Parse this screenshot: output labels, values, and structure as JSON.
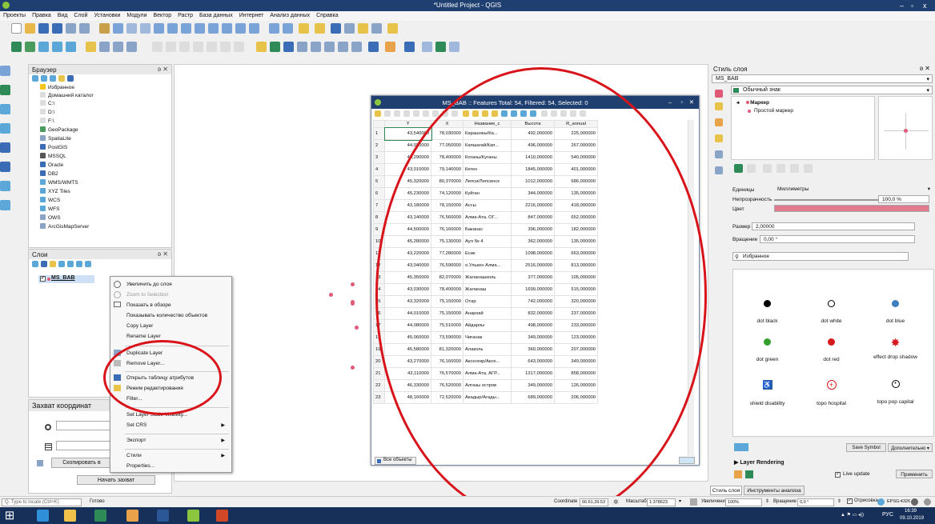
{
  "window": {
    "title": "*Untitled Project - QGIS",
    "controls": [
      "–",
      "▫",
      "x"
    ]
  },
  "menu": [
    "Проекты",
    "Правка",
    "Вид",
    "Слой",
    "Установки",
    "Модули",
    "Вектор",
    "Растр",
    "База данных",
    "Интернет",
    "Анализ данных",
    "Справка"
  ],
  "browser": {
    "title": "Браузер",
    "items": [
      "Избранное",
      "Домашний каталог",
      "C:\\",
      "D:\\",
      "F:\\",
      "GeoPackage",
      "SpatiaLite",
      "PostGIS",
      "MSSQL",
      "Oracle",
      "DB2",
      "WMS/WMTS",
      "XYZ Tiles",
      "WCS",
      "WFS",
      "OWS",
      "ArcGisMapServer"
    ]
  },
  "layers": {
    "title": "Слои",
    "layer_name": "MS_BAB"
  },
  "capture": {
    "title": "Захват координат",
    "copy_button": "Скопировать в",
    "start_button": "Начать захват"
  },
  "context_menu": [
    {
      "label": "Увеличить до слоя",
      "enabled": true
    },
    {
      "label": "Zoom to Selection",
      "enabled": false
    },
    {
      "label": "Показать в обзоре",
      "enabled": true
    },
    {
      "label": "Показывать количество объектов",
      "enabled": true
    },
    {
      "label": "Copy Layer",
      "enabled": true
    },
    {
      "label": "Rename Layer",
      "enabled": true
    },
    {
      "label": "Duplicate Layer",
      "enabled": true
    },
    {
      "label": "Remove Layer...",
      "enabled": true
    },
    {
      "label": "Открыть таблицу атрибутов",
      "enabled": true
    },
    {
      "label": "Режим редактирования",
      "enabled": true
    },
    {
      "label": "Filter...",
      "enabled": true
    },
    {
      "label": "Set Layer Scale Visibility...",
      "enabled": true
    },
    {
      "label": "Set CRS",
      "enabled": true
    },
    {
      "label": "Экспорт",
      "enabled": true
    },
    {
      "label": "Стили",
      "enabled": true
    },
    {
      "label": "Properties...",
      "enabled": true
    }
  ],
  "attribute_table": {
    "title": "MS_BAB :: Features Total: 54, Filtered: 54, Selected: 0",
    "columns": [
      "Y",
      "X",
      "Название_с",
      "Высота",
      "R_annual"
    ],
    "rows": [
      [
        "1",
        "43,540000",
        "78,030000",
        "Карашокы/Ка...",
        "492,000000",
        "225,000000"
      ],
      [
        "2",
        "44,020000",
        "77,050000",
        "Капшагай/Кап...",
        "496,000000",
        "267,000000"
      ],
      [
        "3",
        "44,290000",
        "78,400000",
        "Коганы/Куганы",
        "1410,000000",
        "540,000000"
      ],
      [
        "4",
        "43,010000",
        "79,140000",
        "Кеген",
        "1845,000000",
        "401,000000"
      ],
      [
        "5",
        "45,320000",
        "80,370000",
        "Лепси/Лепсинск",
        "1012,000000",
        "686,000000"
      ],
      [
        "6",
        "45,230000",
        "74,120000",
        "Куйган",
        "344,000000",
        "135,000000"
      ],
      [
        "7",
        "43,180000",
        "78,150000",
        "Ассы",
        "2216,000000",
        "418,000000"
      ],
      [
        "8",
        "43,140000",
        "76,560000",
        "Алма-Ата, ОГ...",
        "847,000000",
        "652,000000"
      ],
      [
        "9",
        "44,500000",
        "76,160000",
        "Баканас",
        "396,000000",
        "182,000000"
      ],
      [
        "10",
        "45,280000",
        "75,130000",
        "Аул № 4",
        "362,000000",
        "135,000000"
      ],
      [
        "11",
        "43,220000",
        "77,280000",
        "Есик",
        "1098,000000",
        "663,000000"
      ],
      [
        "12",
        "43,040000",
        "76,590000",
        "о.Улькен Алма...",
        "2516,000000",
        "813,000000"
      ],
      [
        "13",
        "45,350000",
        "82,070000",
        "Жаланашколь",
        "377,000000",
        "105,000000"
      ],
      [
        "14",
        "43,030000",
        "78,400000",
        "Жаланаш",
        "1699,000000",
        "515,000000"
      ],
      [
        "15",
        "43,320000",
        "75,150000",
        "Отар",
        "742,000000",
        "320,000000"
      ],
      [
        "16",
        "44,010000",
        "75,150000",
        "Анархай",
        "832,000000",
        "237,000000"
      ],
      [
        "17",
        "44,080000",
        "75,510000",
        "Айдарлы",
        "498,000000",
        "233,000000"
      ],
      [
        "18",
        "45,060000",
        "73,590000",
        "Чиганак",
        "349,000000",
        "123,000000"
      ],
      [
        "19",
        "45,580000",
        "81,320000",
        "Алаколь",
        "360,000000",
        "207,000000"
      ],
      [
        "20",
        "43,270000",
        "76,160000",
        "Аксенгир/Аксе...",
        "643,000000",
        "349,000000"
      ],
      [
        "21",
        "43,110000",
        "76,570000",
        "Алма-Ата, АГР...",
        "1317,000000",
        "858,000000"
      ],
      [
        "22",
        "46,330000",
        "76,520000",
        "Алгазы остров",
        "349,000000",
        "126,000000"
      ],
      [
        "23",
        "48,160000",
        "72,520000",
        "Акадыр/Агады...",
        "689,000000",
        "206,000000"
      ]
    ],
    "filter_button": "Все объекты"
  },
  "style_panel": {
    "title": "Стиль слоя",
    "layer_select": "MS_BAB",
    "renderer": "Обычный знак",
    "tree_marker": "Маркер",
    "tree_simple": "Простой маркер",
    "units_label": "Единицы",
    "units_value": "Миллиметры",
    "opacity_label": "Непрозрачность",
    "opacity_value": "100,0 %",
    "color_label": "Цвет",
    "color_value": "#e07a8c",
    "size_label": "Размер",
    "size_value": "2,00000",
    "rotation_label": "Вращение",
    "rotation_value": "0,00 °",
    "favorites_select": "Избранное",
    "symbols": [
      {
        "name": "dot black",
        "icon": "dot-black"
      },
      {
        "name": "dot white",
        "icon": "dot-white"
      },
      {
        "name": "dot blue",
        "icon": "dot-blue"
      },
      {
        "name": "dot green",
        "icon": "dot-green"
      },
      {
        "name": "dot red",
        "icon": "dot-red"
      },
      {
        "name": "effect drop shadow",
        "icon": "star-burst"
      },
      {
        "name": "shield disability",
        "icon": "wheelchair"
      },
      {
        "name": "topo hospital",
        "icon": "hospital"
      },
      {
        "name": "topo pop capital",
        "icon": "pop-capital"
      }
    ],
    "save_symbol_button": "Save Symbol",
    "advanced_button": "Дополнительно ▾",
    "layer_rendering": "Layer Rendering",
    "live_update_label": "Live update",
    "apply_button": "Применить",
    "tab_style": "Стиль слоя",
    "tab_tools": "Инструменты анализа"
  },
  "status": {
    "locator_placeholder": "Q. Type to locate (Ctrl+K)",
    "ready": "Готово",
    "coordinate_label": "Coordinate",
    "coordinate_value": "66.61,39.53",
    "scale_label": "Масштаб",
    "scale_value": "1:378623",
    "magnifier_label": "Увеличение",
    "magnifier_value": "100%",
    "rotation_label": "Вращение",
    "rotation_value": "0,0 °",
    "render_label": "Отрисовка",
    "crs": "EPSG:4326"
  },
  "taskbar": {
    "lang": "РУС",
    "time": "16:39",
    "date": "09.10.2019"
  }
}
